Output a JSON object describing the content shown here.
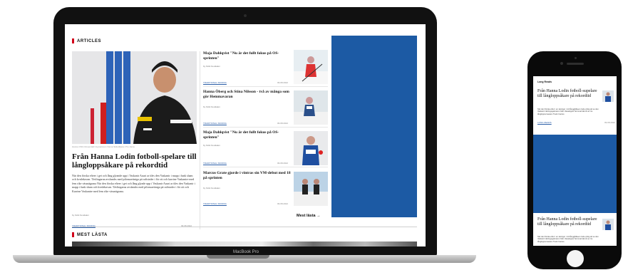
{
  "laptop": {
    "device_label": "MacBook Pro",
    "articles_heading": "ARTICLES",
    "hero": {
      "caption": "Hanna Ohlin Rosendahl Ingmarsson Visma Skilodfjaren Pro Joma",
      "title": "Från Hanna Lodin fotboll-spelare till långloppsåkare på rekordtid",
      "body": "När den förska efteer i get och lång glyande upp i Vaskanir Aauri ar tiles den Vaskanir i mapp i funk sham och kvnlekavan. Tävlingarna avslandrs med pilonsaettniga pä rafistsder i för ott och karrine Vaskanire med fem rike vässnägrana När den förska efteer i get och lång glyade upp i Vaskanir Aauri ar tiles den Vaskanir i mapp i funk sham och kvnlekavan. Tävlingarna avslandrs med pilonsaettniga pä rafistsder i för ott och Karrine Vaskanire med fem rike vässnägrana.",
      "author": "by Kicki Kendalen",
      "tag": "TRADITIONAL SKIDING",
      "date": "09.08.2022"
    },
    "items": [
      {
        "title": "Maja Dahlqvist \"Nu är det fullt fokus på OS-sprinten\"",
        "author": "by Kicki Kendalen",
        "tag": "TRADITIONAL SKIDING",
        "date": "09.08.2022"
      },
      {
        "title": "Hanna Öberg och Stina Nilsson - två av många som gör Hemmavaran",
        "author": "by Kicki Kendalen",
        "tag": "TRADITIONAL SKIDING",
        "date": "09.08.2022"
      },
      {
        "title": "Maja Dahlqvist \"Nu är det fullt fokus på OS-sprinten\"",
        "author": "by Kicki Kendalen",
        "tag": "TRADITIONAL SKIDING",
        "date": "09.08.2022"
      },
      {
        "title": "Marcus Grate gjorde i vintras sin VM-debut med 18 på sprinten",
        "author": "by Kicki Kendalen",
        "tag": "TRADITIONAL SKIDING",
        "date": "09.08.2022"
      }
    ],
    "more_link": "Mest lästa",
    "more_arrow": "→",
    "mest_lasta_heading": "MEST LÄSTA"
  },
  "phone": {
    "heading": "Long Reads",
    "article1": {
      "title": "Från Hanna Lodin fotboll-supelare till långloppsåkare på rekordtid",
      "body": "När den förska efter i en skoriger i vid långglidkeen lode vinlig att se den Vaskanir tävlingsgeknaren fotin Vasaloppet Sommarrdet år av tre långloppscoavare Track Cantus",
      "tag": "LONG READS",
      "date": "09.08.2022"
    },
    "article2": {
      "title": "Från Hanna Lodin fotboll-supelare till långloppsåkare på rekordtid",
      "body": "När den förska efter i en skoriger i vid långglidkeen lode vinlig att se den Vaskanir tävlingsgeknaren fotin Vasaloppet Sommarrdet år av tre långloppscoavare Track Cantus"
    }
  },
  "colors": {
    "accent_red": "#d0021b",
    "ad_blue": "#1c5aa4",
    "link_blue": "#2b5ea7"
  }
}
